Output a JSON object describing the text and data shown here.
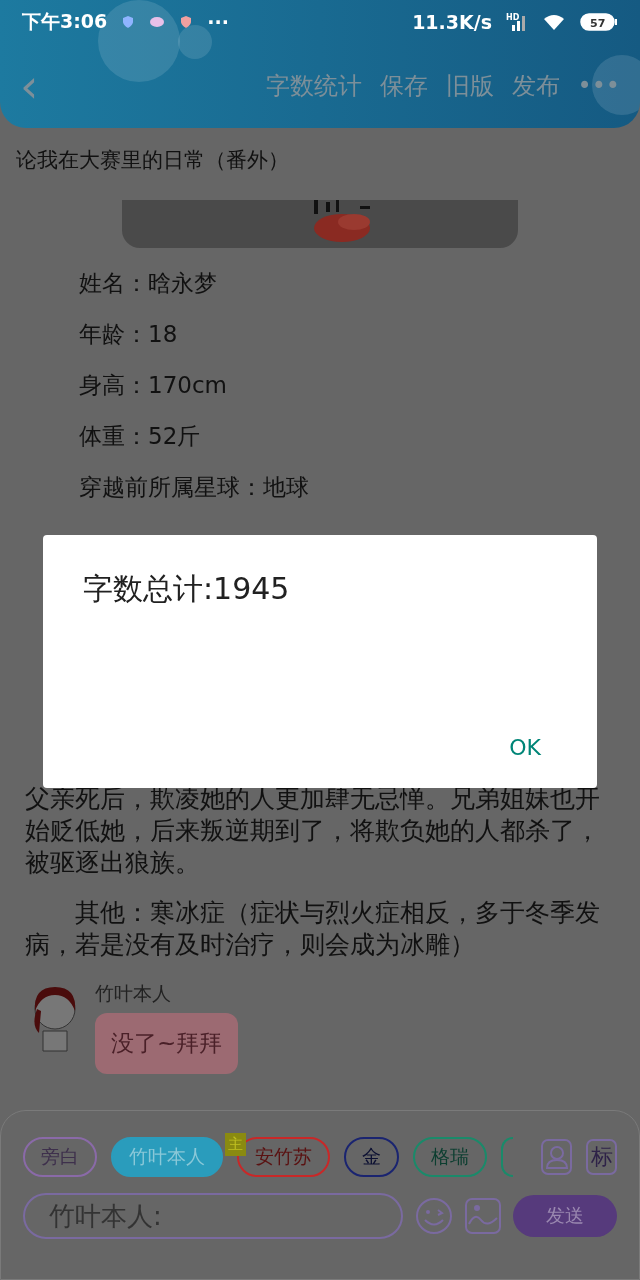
{
  "status_bar": {
    "time": "下午3:06",
    "more": "···",
    "speed": "11.3K/s",
    "network": "HD",
    "battery": "57"
  },
  "header": {
    "back": "‹",
    "actions": [
      "字数统计",
      "保存",
      "旧版",
      "发布"
    ],
    "more": "•••"
  },
  "document": {
    "title": "论我在大赛里的日常（番外）",
    "above_dialog": [
      {
        "kind": "line",
        "text": "姓名：晗永梦"
      },
      {
        "kind": "line",
        "text": "年龄：18"
      },
      {
        "kind": "line",
        "text": "身高：170cm"
      },
      {
        "kind": "line",
        "text": "体重：52斤"
      },
      {
        "kind": "line",
        "text": "穿越前所属星球：地球"
      }
    ],
    "below_dialog": [
      {
        "kind": "paragraph",
        "text": "父亲死后，欺凌她的人更加肆无忌惮。兄弟姐妹也开始贬低她，后来叛逆期到了，将欺负她的人都杀了，被驱逐出狼族。"
      },
      {
        "kind": "indented",
        "text": "其他：寒冰症（症状与烈火症相反，多于冬季发病，若是没有及时治疗，则会成为冰雕）"
      }
    ]
  },
  "message": {
    "sender": "竹叶本人",
    "text": "没了~拜拜"
  },
  "roles": [
    {
      "label": "旁白",
      "color": "#8a6aa8",
      "selected": false
    },
    {
      "label": "竹叶本人",
      "color": "#2a9cbc",
      "selected": true
    },
    {
      "label": "安竹苏",
      "color": "#c82828",
      "selected": false,
      "badge": "主"
    },
    {
      "label": "金",
      "color": "#1a2470",
      "selected": false
    },
    {
      "label": "格瑞",
      "color": "#1a8a6a",
      "selected": false
    },
    {
      "kind": "partial",
      "color": "#1a8a6a",
      "selected": false
    }
  ],
  "tools": {
    "mark": "标"
  },
  "composer": {
    "value": "竹叶本人:",
    "send": "发送"
  },
  "dialog": {
    "message": "字数总计:1945",
    "ok": "OK"
  }
}
